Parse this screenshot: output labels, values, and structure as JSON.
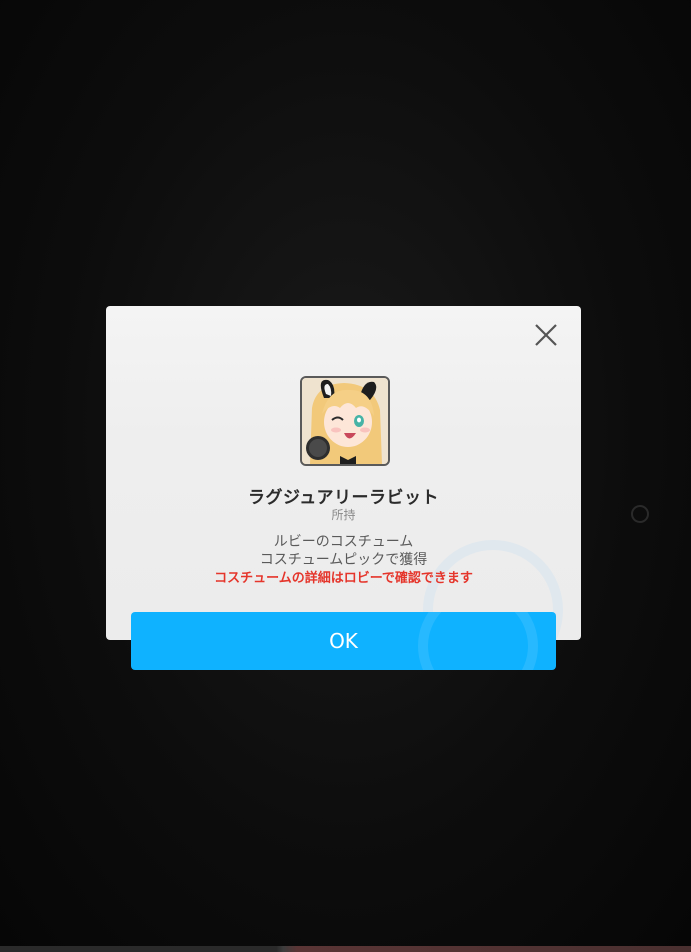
{
  "dialog": {
    "close_icon": "close-icon",
    "item": {
      "icon": "costume-portrait-icon",
      "name": "ラグジュアリーラビット",
      "status": "所持"
    },
    "description": {
      "line1": "ルビーのコスチューム",
      "line2": "コスチュームピックで獲得",
      "warning": "コスチュームの詳細はロビーで確認できます"
    },
    "ok_label": "OK"
  },
  "colors": {
    "accent": "#0fb2ff",
    "warning": "#e5352b",
    "panel": "#efefef"
  }
}
